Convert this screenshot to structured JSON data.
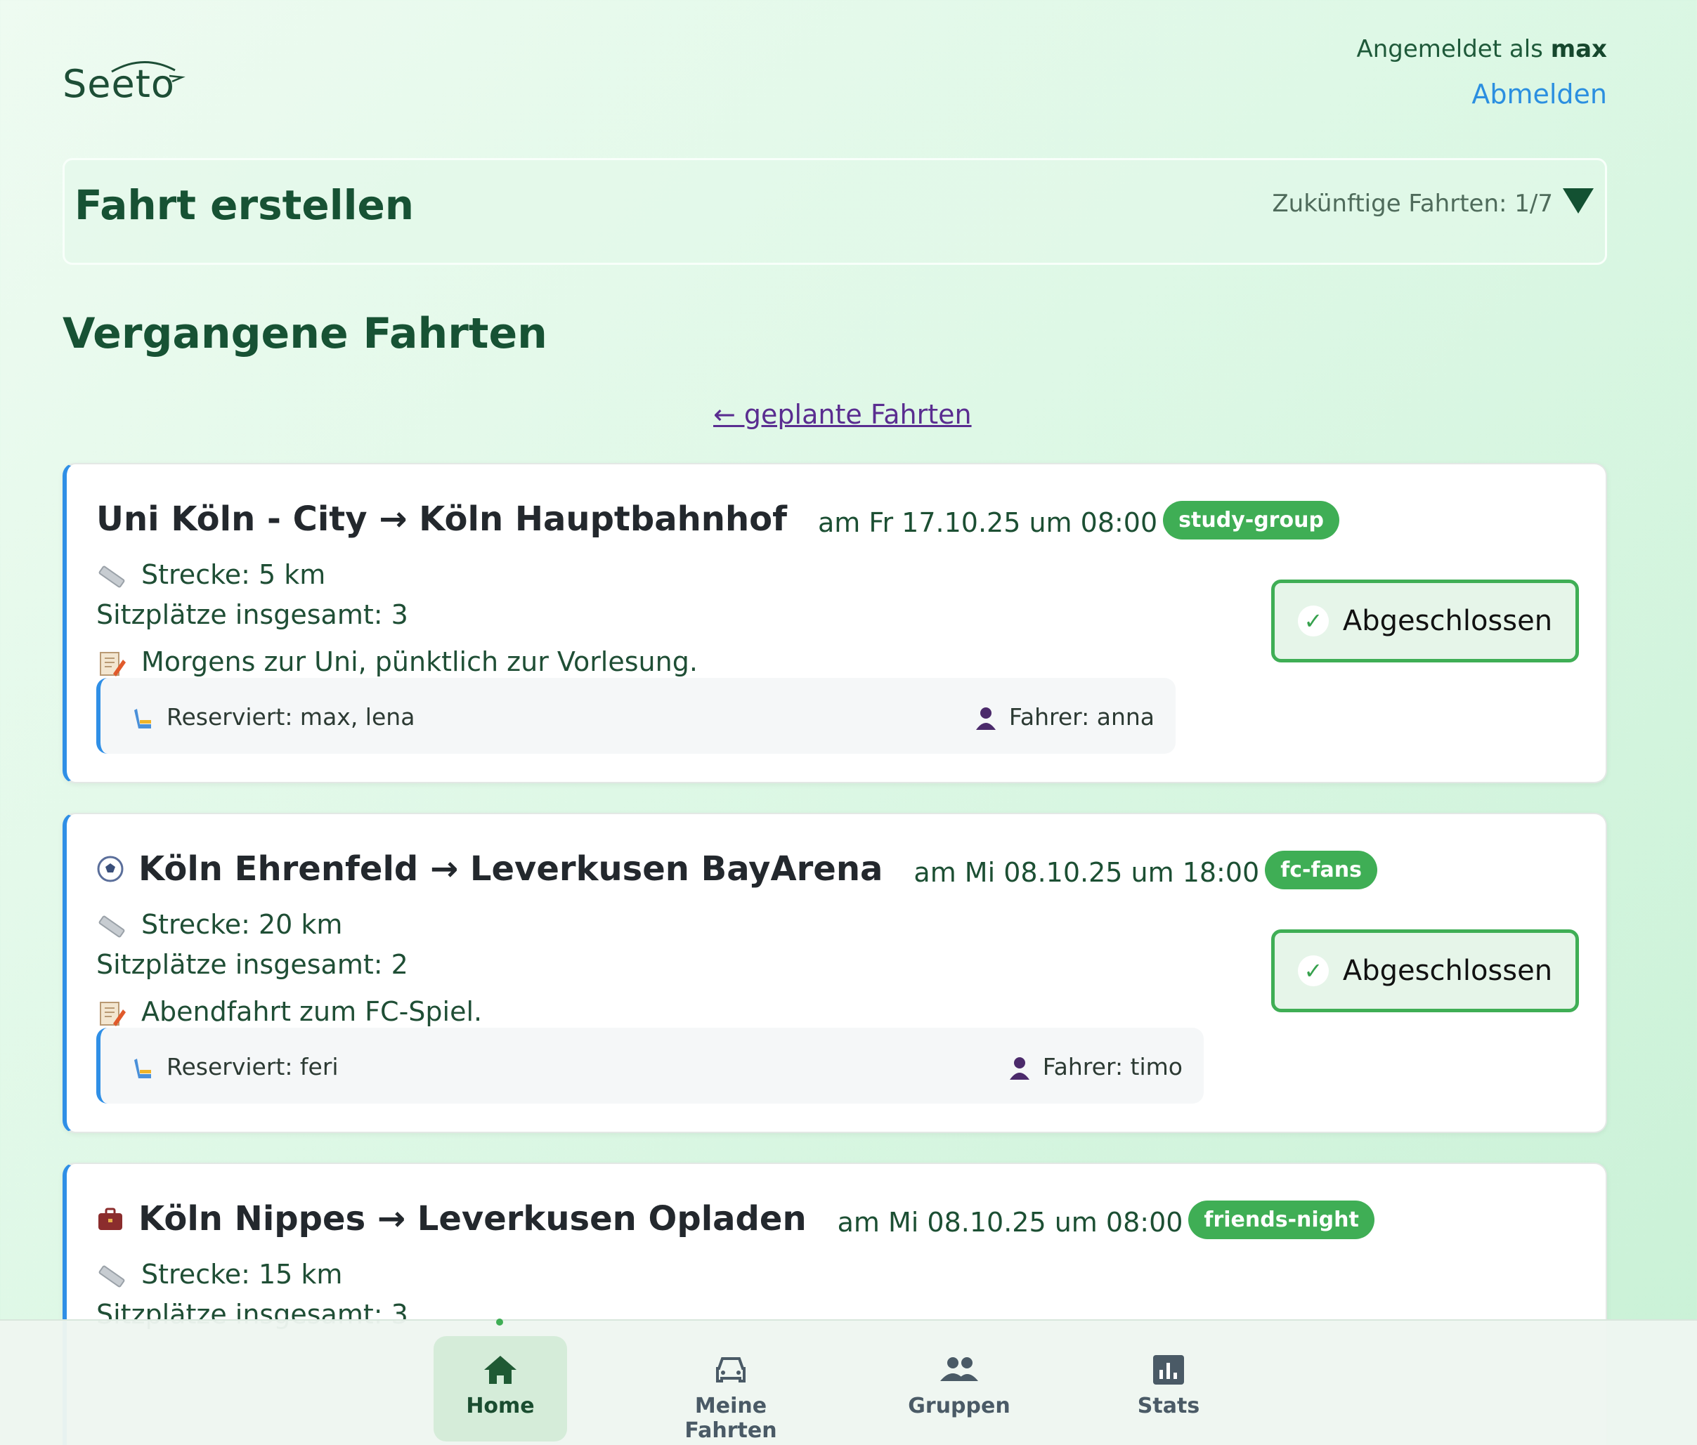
{
  "header": {
    "logo": "Seeto",
    "logged_in_prefix": "Angemeldet als",
    "username": "max",
    "logout": "Abmelden"
  },
  "create_panel": {
    "title": "Fahrt erstellen",
    "future_rides": "Zukünftige Fahrten: 1/7"
  },
  "section": {
    "title": "Vergangene Fahrten",
    "planned_link": "← geplante Fahrten"
  },
  "rides": [
    {
      "route": "Uni Köln - City → Köln Hauptbahnhof",
      "when": "am Fr 17.10.25 um 08:00",
      "badge": "study-group",
      "distance": "Strecke: 5 km",
      "seats": "Sitzplätze insgesamt: 3",
      "note": "Morgens zur Uni, pünktlich zur Vorlesung.",
      "reserved": "Reserviert: max, lena",
      "driver": "Fahrer: anna",
      "status": "Abgeschlossen"
    },
    {
      "route": "Köln Ehrenfeld → Leverkusen BayArena",
      "when": "am Mi 08.10.25 um 18:00",
      "badge": "fc-fans",
      "distance": "Strecke: 20 km",
      "seats": "Sitzplätze insgesamt: 2",
      "note": "Abendfahrt zum FC-Spiel.",
      "reserved": "Reserviert: feri",
      "driver": "Fahrer: timo",
      "status": "Abgeschlossen"
    },
    {
      "route": "Köln Nippes → Leverkusen Opladen",
      "when": "am Mi 08.10.25 um 08:00",
      "badge": "friends-night",
      "distance": "Strecke: 15 km",
      "seats": "Sitzplätze insgesamt: 3"
    }
  ],
  "nav": {
    "home": "Home",
    "my_rides": "Meine Fahrten",
    "groups": "Gruppen",
    "stats": "Stats"
  }
}
